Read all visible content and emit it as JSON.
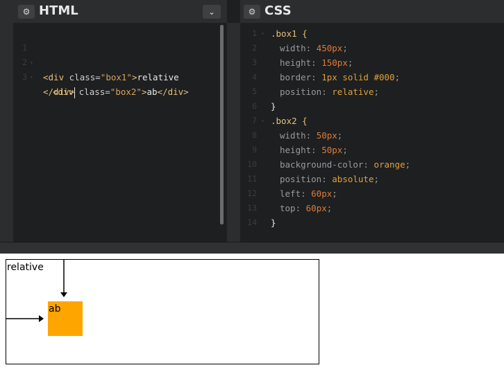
{
  "html_pane": {
    "title": "HTML",
    "settings_icon": "gear-icon",
    "collapse_icon": "chevron-down-icon",
    "lines": [
      {
        "num": "1",
        "fold": "▾"
      },
      {
        "num": "2",
        "fold": "▾"
      },
      {
        "num": "3",
        "fold": ""
      }
    ],
    "code": {
      "l1_open": "<div ",
      "l1_attr": "class=",
      "l1_str": "\"box1\"",
      "l1_close": ">",
      "l1_text": "relative",
      "l2_open": "<div ",
      "l2_attr": "class=",
      "l2_str": "\"box2\"",
      "l2_close": ">",
      "l2_text": "ab",
      "l2_end": "</div>",
      "l3_end": "</div>"
    }
  },
  "css_pane": {
    "title": "CSS",
    "settings_icon": "gear-icon",
    "lines": [
      {
        "num": "1",
        "fold": "▾",
        "sel": ".box1 {",
        "prop": "",
        "val": "",
        "cls": ""
      },
      {
        "num": "2",
        "fold": "",
        "sel": "",
        "prop": "width: ",
        "val": "450px",
        "cls": "num"
      },
      {
        "num": "3",
        "fold": "",
        "sel": "",
        "prop": "height: ",
        "val": "150px",
        "cls": "num"
      },
      {
        "num": "4",
        "fold": "",
        "sel": "",
        "prop": "border: ",
        "val": "1px solid #000",
        "cls": "kw"
      },
      {
        "num": "5",
        "fold": "",
        "sel": "",
        "prop": "position: ",
        "val": "relative",
        "cls": "kw"
      },
      {
        "num": "6",
        "fold": "",
        "sel": "}",
        "prop": "",
        "val": "",
        "cls": ""
      },
      {
        "num": "7",
        "fold": "▾",
        "sel": ".box2 {",
        "prop": "",
        "val": "",
        "cls": ""
      },
      {
        "num": "8",
        "fold": "",
        "sel": "",
        "prop": "width: ",
        "val": "50px",
        "cls": "num"
      },
      {
        "num": "9",
        "fold": "",
        "sel": "",
        "prop": "height: ",
        "val": "50px",
        "cls": "num"
      },
      {
        "num": "10",
        "fold": "",
        "sel": "",
        "prop": "background-color: ",
        "val": "orange",
        "cls": "kw"
      },
      {
        "num": "11",
        "fold": "",
        "sel": "",
        "prop": "position: ",
        "val": "absolute",
        "cls": "kw"
      },
      {
        "num": "12",
        "fold": "",
        "sel": "",
        "prop": "left: ",
        "val": "60px",
        "cls": "num"
      },
      {
        "num": "13",
        "fold": "",
        "sel": "",
        "prop": "top: ",
        "val": "60px",
        "cls": "num"
      },
      {
        "num": "14",
        "fold": "",
        "sel": "}",
        "prop": "",
        "val": "",
        "cls": ""
      }
    ]
  },
  "result": {
    "box1_text": "relative",
    "box2_text": "ab",
    "box2_color": "#ffa500"
  }
}
